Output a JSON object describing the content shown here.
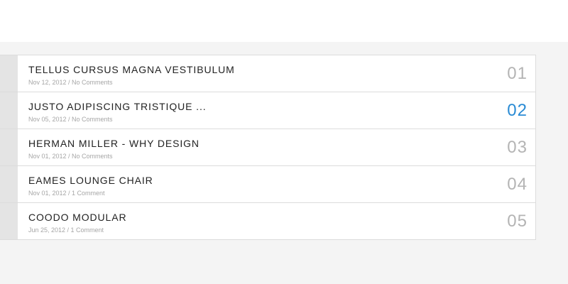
{
  "posts": [
    {
      "title": "TELLUS CURSUS MAGNA VESTIBULUM",
      "meta": "Nov 12, 2012 / No Comments",
      "number": "01",
      "active": false
    },
    {
      "title": "JUSTO ADIPISCING TRISTIQUE ...",
      "meta": "Nov 05, 2012 / No Comments",
      "number": "02",
      "active": true
    },
    {
      "title": "HERMAN MILLER - WHY DESIGN",
      "meta": "Nov 01, 2012 / No Comments",
      "number": "03",
      "active": false
    },
    {
      "title": "EAMES LOUNGE CHAIR",
      "meta": "Nov 01, 2012 / 1 Comment",
      "number": "04",
      "active": false
    },
    {
      "title": "COODO MODULAR",
      "meta": "Jun 25, 2012 / 1 Comment",
      "number": "05",
      "active": false
    }
  ],
  "colors": {
    "accent": "#2a8bd4",
    "number_default": "#b4b4b4",
    "title": "#222222",
    "meta": "#a6a6a6"
  }
}
